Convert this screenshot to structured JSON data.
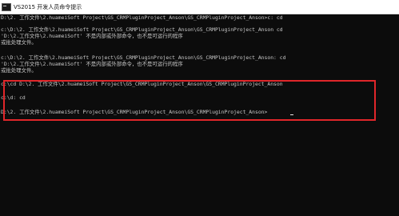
{
  "window": {
    "title": "VS2015 开发人员命令提示",
    "icon": "console-icon"
  },
  "console": {
    "lines": [
      "D:\\2. 工作文件\\2.huameiSoft Project\\GS_CRMPluginProject_Anson\\GS_CRMPluginProject_Anson>c: cd",
      "",
      "c:\\D:\\2. 工作文件\\2.huameiSoft Project\\GS_CRMPluginProject_Anson\\GS_CRMPluginProject_Anson cd",
      "'D:\\2.工作文件\\2.huameiSoft' 不是内部或外部命令，也不是可运行的程序",
      "或批处理文件。",
      "",
      "c:\\D:\\2. 工作文件\\2.huameiSoft Project\\GS_CRMPluginProject_Anson\\GS_CRMPluginProject_Anson: cd",
      "'D:\\2.工作文件\\2.huameiSoft' 不是内部或外部命令，也不是可运行的程序",
      "或批处理文件。",
      "",
      "",
      "c:\\cd D:\\2. 工作文件\\2.huameiSoft Project\\GS_CRMPluginProject_Anson\\GS_CRMPluginProject_Anson",
      "",
      "c:\\d: cd",
      "",
      "D:\\2. 工作文件\\2.huameiSoft Project\\GS_CRMPluginProject_Anson\\GS_CRMPluginProject_Anson>"
    ]
  },
  "colors": {
    "console_bg": "#0c0c0c",
    "console_text": "#c8c8c8",
    "highlight_border": "#e0262a",
    "titlebar_bg": "#ffffff"
  }
}
